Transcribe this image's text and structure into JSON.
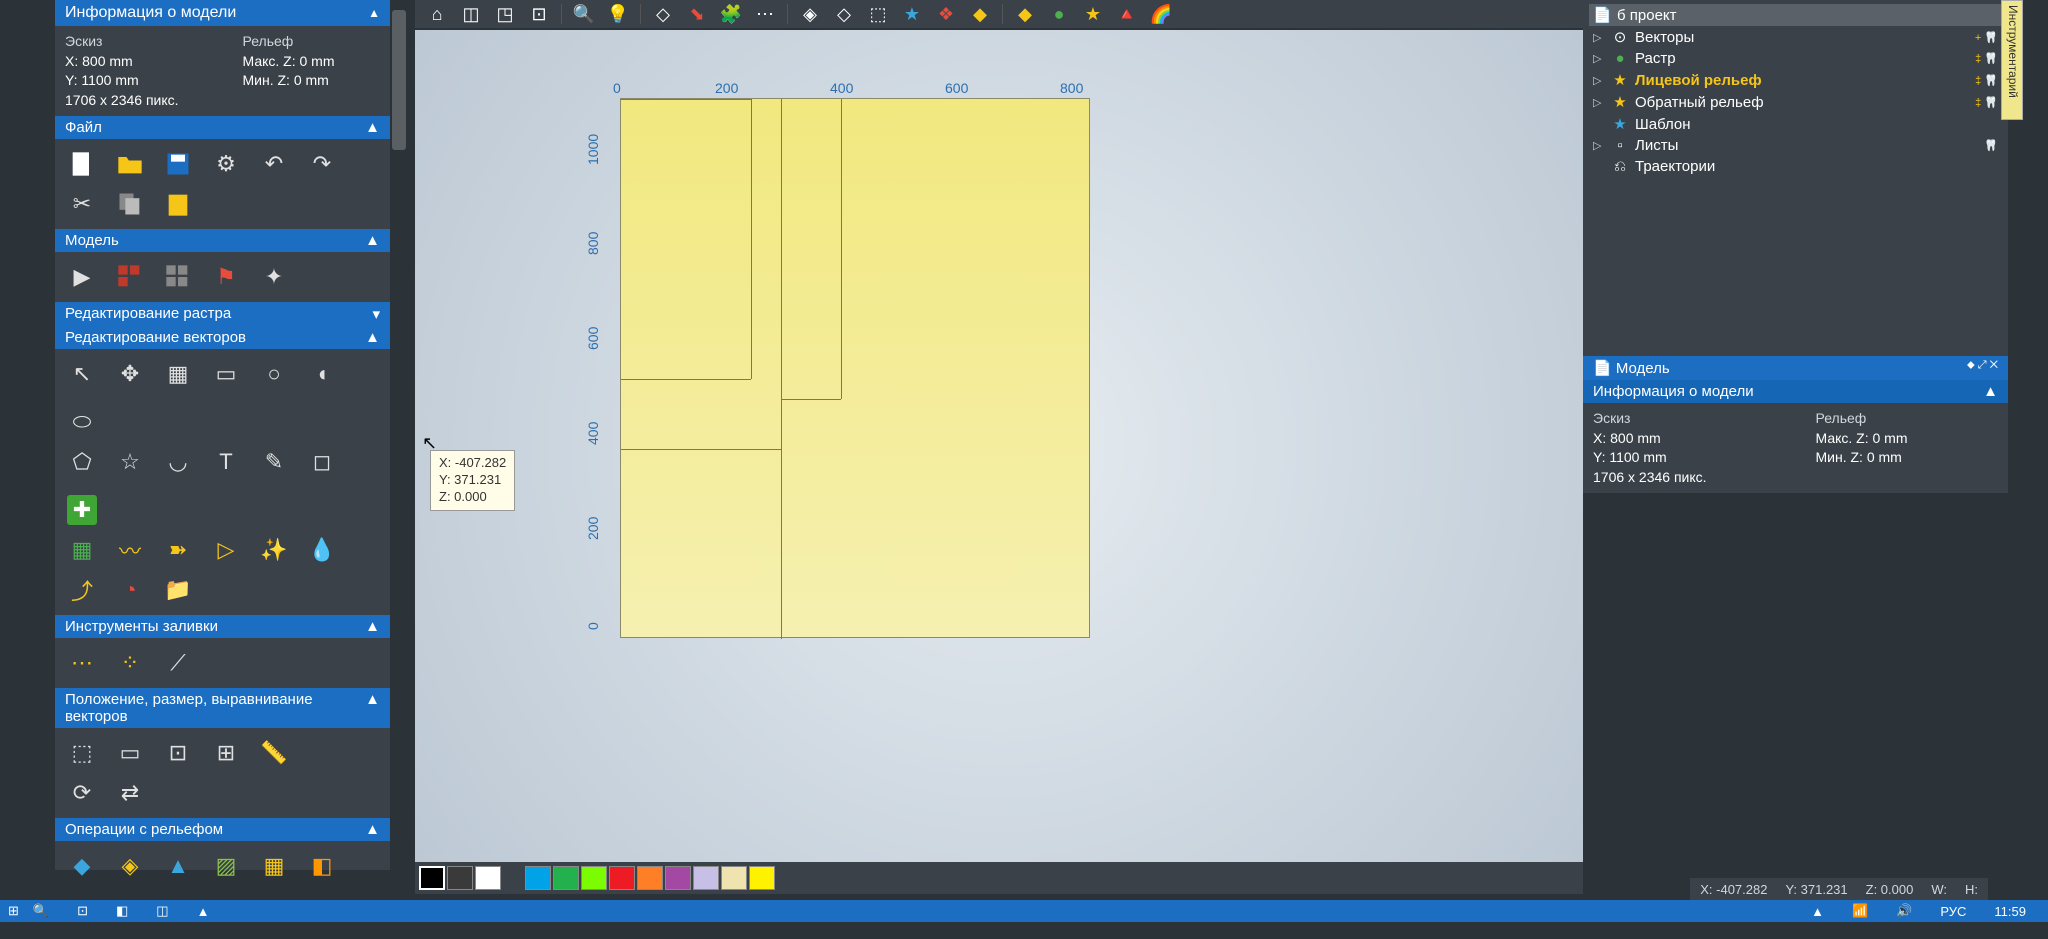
{
  "left": {
    "model_info_header": "Информация о модели",
    "sketch_label": "Эскиз",
    "x_label": "X: 800 mm",
    "y_label": "Y: 1100 mm",
    "px_label": "1706 x 2346 пикс.",
    "relief_label": "Рельеф",
    "maxz_label": "Макс. Z: 0 mm",
    "minz_label": "Мин. Z: 0 mm",
    "file_header": "Файл",
    "model_header": "Модель",
    "raster_header": "Редактирование растра",
    "vector_header": "Редактирование векторов",
    "fill_header": "Инструменты заливки",
    "pos_header": "Положение, размер, выравнивание векторов",
    "relief_ops_header": "Операции с рельефом"
  },
  "tooltip": {
    "x": "X: -407.282",
    "y": "Y: 371.231",
    "z": "Z: 0.000"
  },
  "ruler_h": {
    "t0": "0",
    "t200": "200",
    "t400": "400",
    "t600": "600",
    "t800": "800"
  },
  "ruler_v": {
    "t0": "0",
    "t200": "200",
    "t400": "400",
    "t600": "600",
    "t800": "800",
    "t1000": "1000"
  },
  "right": {
    "project": "б проект",
    "vectors": "Векторы",
    "raster": "Растр",
    "face_relief": "Лицевой рельеф",
    "back_relief": "Обратный рельеф",
    "template": "Шаблон",
    "sheets": "Листы",
    "toolpaths": "Траектории",
    "model_panel": "Модель",
    "model_info": "Информация о модели",
    "sketch_label": "Эскиз",
    "x_label": "X: 800 mm",
    "y_label": "Y: 1100 mm",
    "px_label": "1706 x 2346 пикс.",
    "relief_label": "Рельеф",
    "maxz_label": "Макс. Z: 0 mm",
    "minz_label": "Мин. Z: 0 mm",
    "vtab": "Инструментарий"
  },
  "status": {
    "x": "X: -407.282",
    "y": "Y: 371.231",
    "z": "Z: 0.000",
    "w": "W:",
    "h": "H:",
    "lang": "РУС",
    "time": "11:59"
  },
  "swatches": [
    "#000000",
    "#3a3a3a",
    "#ffffff",
    "",
    "#00a2e8",
    "#22b14c",
    "#7cfc00",
    "#ed1c24",
    "#ff7f27",
    "#a349a4",
    "#c8bfe7",
    "#efe4b0",
    "#fff200"
  ]
}
